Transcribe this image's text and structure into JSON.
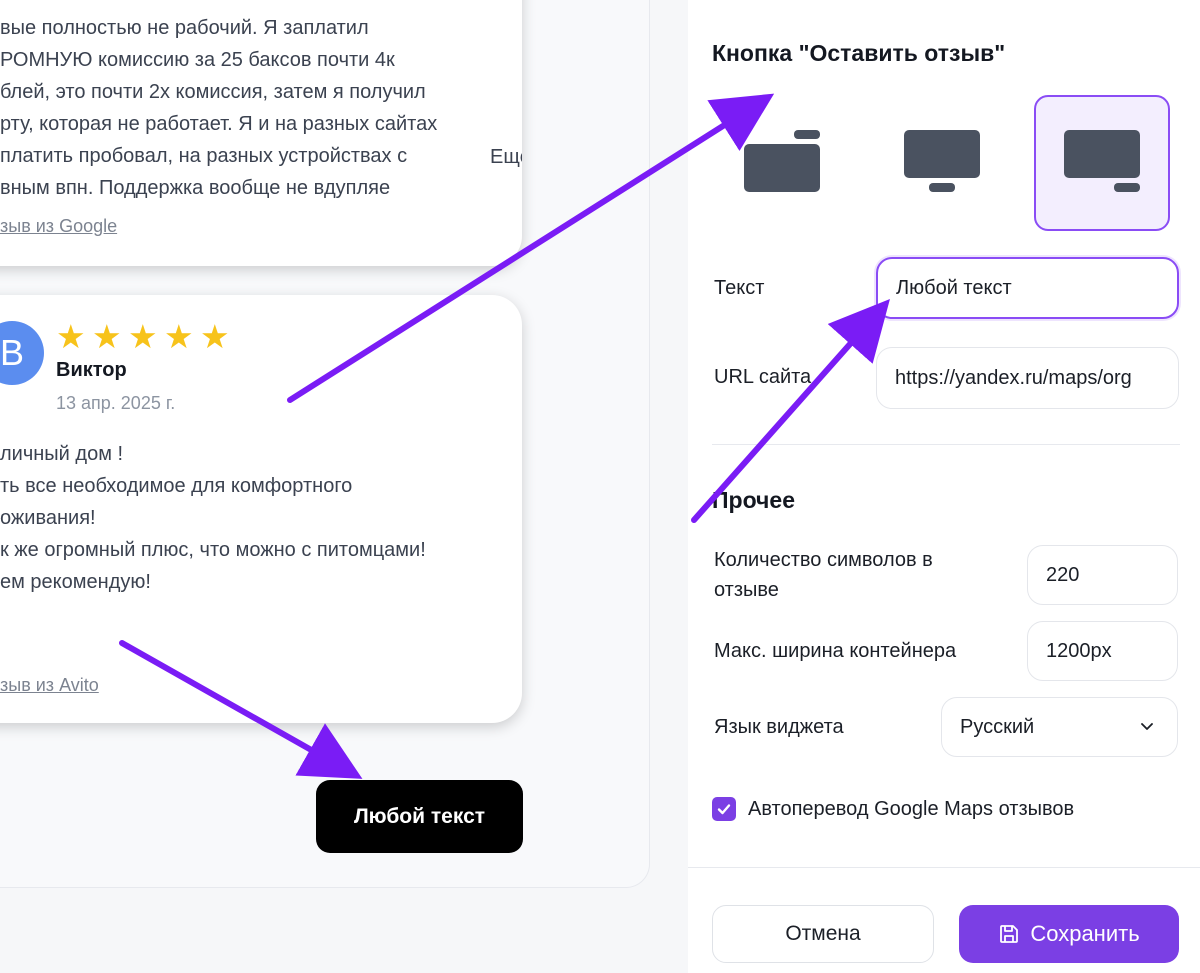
{
  "preview": {
    "review1": {
      "lines": [
        "вые полностью не рабочий. Я заплатил",
        "РОМНУЮ комиссию за 25 баксов почти 4к",
        "блей, это почти 2х комиссия, затем я получил",
        "рту, которая не работает. Я и на разных сайтах",
        "платить пробовал, на разных устройствах с",
        "вным впн. Поддержка вообще не вдупляе"
      ],
      "more": "Ещё",
      "source": "зыв из Google"
    },
    "review2": {
      "avatar_letter": "В",
      "rating": 5,
      "author": "Виктор",
      "date": "13 апр. 2025 г.",
      "lines": [
        "личный дом !",
        "ть все необходимое для комфортного",
        "оживания!",
        "к же огромный плюс, что можно с питомцами!",
        "ем рекомендую!"
      ],
      "source": "зыв из Avito"
    },
    "leave_review_button": "Любой текст"
  },
  "settings": {
    "button_section_title": "Кнопка \"Оставить отзыв\"",
    "button_positions": [
      {
        "name": "top-right",
        "selected": false
      },
      {
        "name": "bottom-center",
        "selected": false
      },
      {
        "name": "bottom-right",
        "selected": true
      }
    ],
    "text_label": "Текст",
    "text_value": "Любой текст",
    "url_label": "URL сайта",
    "url_value": "https://yandex.ru/maps/org",
    "other_title": "Прочее",
    "chars_label_line1": "Количество символов в",
    "chars_label_line2": "отзыве",
    "chars_value": "220",
    "width_label": "Макс. ширина контейнера",
    "width_value": "1200px",
    "lang_label": "Язык виджета",
    "lang_value": "Русский",
    "autotranslate_label": "Автоперевод Google Maps отзывов",
    "autotranslate_checked": true
  },
  "footer": {
    "cancel": "Отмена",
    "save": "Сохранить"
  },
  "colors": {
    "accent": "#7b3fe4",
    "star": "#f7c31b",
    "avatar": "#5b8def",
    "arrow": "#7a1cf5"
  }
}
